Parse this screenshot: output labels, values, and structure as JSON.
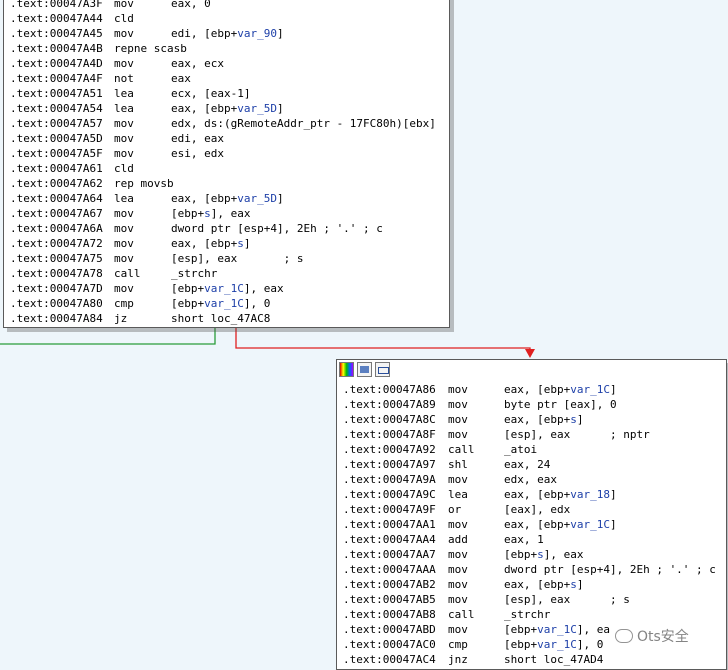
{
  "top_block": {
    "rows": [
      {
        "addr": ".text:00047A3F",
        "mn": "mov",
        "op": "eax, 0",
        "var": "",
        "tail": "",
        "cmt": ""
      },
      {
        "addr": ".text:00047A44",
        "mn": "cld",
        "op": "",
        "var": "",
        "tail": "",
        "cmt": ""
      },
      {
        "addr": ".text:00047A45",
        "mn": "mov",
        "op": "edi, [ebp+",
        "var": "var_90",
        "tail": "]",
        "cmt": ""
      },
      {
        "addr": ".text:00047A4B",
        "mn": "repne scasb",
        "op": "",
        "var": "",
        "tail": "",
        "cmt": ""
      },
      {
        "addr": ".text:00047A4D",
        "mn": "mov",
        "op": "eax, ecx",
        "var": "",
        "tail": "",
        "cmt": ""
      },
      {
        "addr": ".text:00047A4F",
        "mn": "not",
        "op": "eax",
        "var": "",
        "tail": "",
        "cmt": ""
      },
      {
        "addr": ".text:00047A51",
        "mn": "lea",
        "op": "ecx, [eax-1]",
        "var": "",
        "tail": "",
        "cmt": ""
      },
      {
        "addr": ".text:00047A54",
        "mn": "lea",
        "op": "eax, [ebp+",
        "var": "var_5D",
        "tail": "]",
        "cmt": ""
      },
      {
        "addr": ".text:00047A57",
        "mn": "mov",
        "op": "edx, ds:(gRemoteAddr_ptr - 17FC80h)[ebx]",
        "var": "",
        "tail": "",
        "cmt": ""
      },
      {
        "addr": ".text:00047A5D",
        "mn": "mov",
        "op": "edi, eax",
        "var": "",
        "tail": "",
        "cmt": ""
      },
      {
        "addr": ".text:00047A5F",
        "mn": "mov",
        "op": "esi, edx",
        "var": "",
        "tail": "",
        "cmt": ""
      },
      {
        "addr": ".text:00047A61",
        "mn": "cld",
        "op": "",
        "var": "",
        "tail": "",
        "cmt": ""
      },
      {
        "addr": ".text:00047A62",
        "mn": "rep movsb",
        "op": "",
        "var": "",
        "tail": "",
        "cmt": ""
      },
      {
        "addr": ".text:00047A64",
        "mn": "lea",
        "op": "eax, [ebp+",
        "var": "var_5D",
        "tail": "]",
        "cmt": ""
      },
      {
        "addr": ".text:00047A67",
        "mn": "mov",
        "op": "[ebp+",
        "var": "s",
        "tail": "], eax",
        "cmt": ""
      },
      {
        "addr": ".text:00047A6A",
        "mn": "mov",
        "op": "dword ptr [esp+4], 2Eh ; '.' ; c",
        "var": "",
        "tail": "",
        "cmt": ""
      },
      {
        "addr": ".text:00047A72",
        "mn": "mov",
        "op": "eax, [ebp+",
        "var": "s",
        "tail": "]",
        "cmt": ""
      },
      {
        "addr": ".text:00047A75",
        "mn": "mov",
        "op": "[esp], eax",
        "var": "",
        "tail": "",
        "cmt": "       ; s"
      },
      {
        "addr": ".text:00047A78",
        "mn": "call",
        "op": "_strchr",
        "var": "",
        "tail": "",
        "cmt": ""
      },
      {
        "addr": ".text:00047A7D",
        "mn": "mov",
        "op": "[ebp+",
        "var": "var_1C",
        "tail": "], eax",
        "cmt": ""
      },
      {
        "addr": ".text:00047A80",
        "mn": "cmp",
        "op": "[ebp+",
        "var": "var_1C",
        "tail": "], 0",
        "cmt": ""
      },
      {
        "addr": ".text:00047A84",
        "mn": "jz",
        "op": "short loc_47AC8",
        "var": "",
        "tail": "",
        "cmt": ""
      }
    ]
  },
  "bottom_block": {
    "toolbar_icons": [
      "color-icon",
      "image-icon",
      "group-icon"
    ],
    "rows": [
      {
        "addr": ".text:00047A86",
        "mn": "mov",
        "op": "eax, [ebp+",
        "var": "var_1C",
        "tail": "]",
        "cmt": ""
      },
      {
        "addr": ".text:00047A89",
        "mn": "mov",
        "op": "byte ptr [eax], 0",
        "var": "",
        "tail": "",
        "cmt": ""
      },
      {
        "addr": ".text:00047A8C",
        "mn": "mov",
        "op": "eax, [ebp+",
        "var": "s",
        "tail": "]",
        "cmt": ""
      },
      {
        "addr": ".text:00047A8F",
        "mn": "mov",
        "op": "[esp], eax",
        "var": "",
        "tail": "",
        "cmt": "      ; nptr"
      },
      {
        "addr": ".text:00047A92",
        "mn": "call",
        "op": "_atoi",
        "var": "",
        "tail": "",
        "cmt": ""
      },
      {
        "addr": ".text:00047A97",
        "mn": "shl",
        "op": "eax, 24",
        "var": "",
        "tail": "",
        "cmt": ""
      },
      {
        "addr": ".text:00047A9A",
        "mn": "mov",
        "op": "edx, eax",
        "var": "",
        "tail": "",
        "cmt": ""
      },
      {
        "addr": ".text:00047A9C",
        "mn": "lea",
        "op": "eax, [ebp+",
        "var": "var_18",
        "tail": "]",
        "cmt": ""
      },
      {
        "addr": ".text:00047A9F",
        "mn": "or",
        "op": "[eax], edx",
        "var": "",
        "tail": "",
        "cmt": ""
      },
      {
        "addr": ".text:00047AA1",
        "mn": "mov",
        "op": "eax, [ebp+",
        "var": "var_1C",
        "tail": "]",
        "cmt": ""
      },
      {
        "addr": ".text:00047AA4",
        "mn": "add",
        "op": "eax, 1",
        "var": "",
        "tail": "",
        "cmt": ""
      },
      {
        "addr": ".text:00047AA7",
        "mn": "mov",
        "op": "[ebp+",
        "var": "s",
        "tail": "], eax",
        "cmt": ""
      },
      {
        "addr": ".text:00047AAA",
        "mn": "mov",
        "op": "dword ptr [esp+4], 2Eh ; '.' ; c",
        "var": "",
        "tail": "",
        "cmt": ""
      },
      {
        "addr": ".text:00047AB2",
        "mn": "mov",
        "op": "eax, [ebp+",
        "var": "s",
        "tail": "]",
        "cmt": ""
      },
      {
        "addr": ".text:00047AB5",
        "mn": "mov",
        "op": "[esp], eax",
        "var": "",
        "tail": "",
        "cmt": "      ; s"
      },
      {
        "addr": ".text:00047AB8",
        "mn": "call",
        "op": "_strchr",
        "var": "",
        "tail": "",
        "cmt": ""
      },
      {
        "addr": ".text:00047ABD",
        "mn": "mov",
        "op": "[ebp+",
        "var": "var_1C",
        "tail": "], ea",
        "cmt": ""
      },
      {
        "addr": ".text:00047AC0",
        "mn": "cmp",
        "op": "[ebp+",
        "var": "var_1C",
        "tail": "], 0",
        "cmt": ""
      },
      {
        "addr": ".text:00047AC4",
        "mn": "jnz",
        "op": "short loc_47AD4",
        "var": "",
        "tail": "",
        "cmt": ""
      }
    ]
  },
  "edges": {
    "false_branch_color": "#e02020",
    "true_branch_color": "#2a9d3a"
  },
  "watermark": {
    "text": "Ots安全"
  },
  "colors": {
    "background": "#eef6fb",
    "variable": "#1d3fa8"
  }
}
